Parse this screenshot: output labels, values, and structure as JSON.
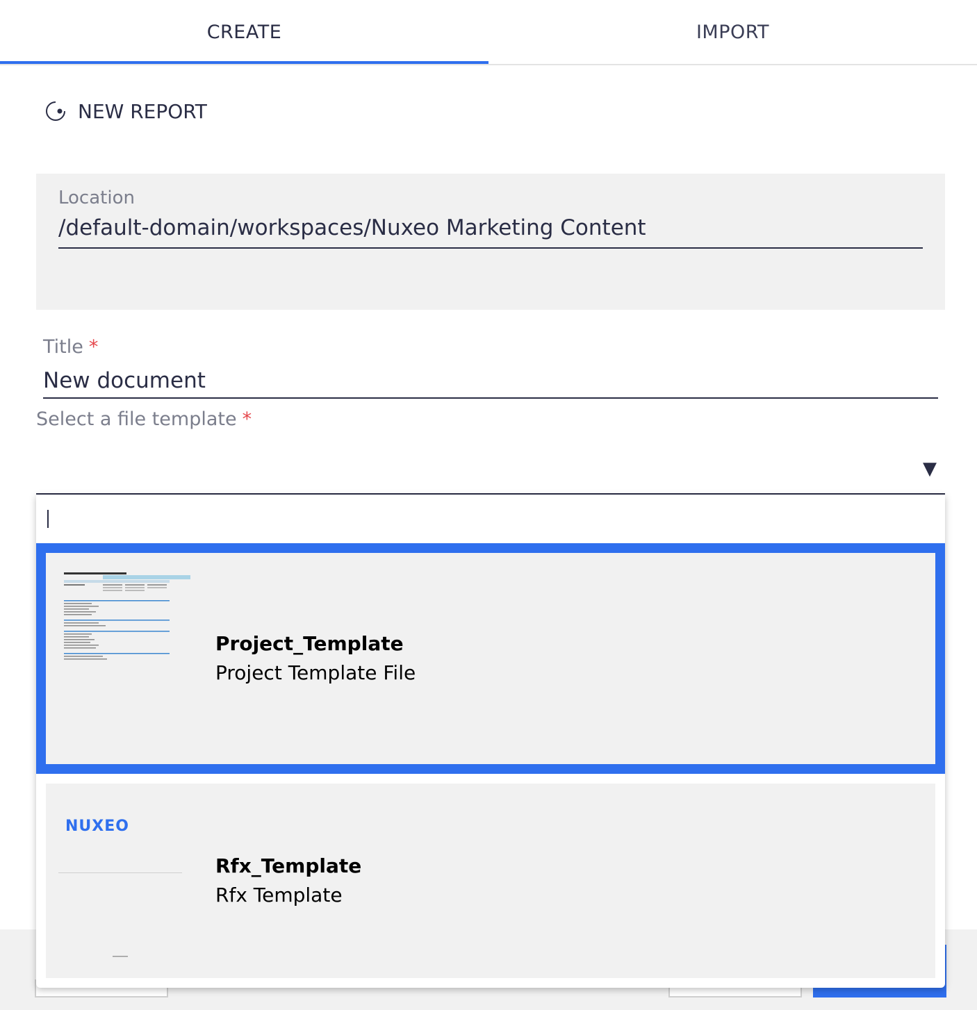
{
  "tabs": [
    {
      "label": "CREATE",
      "active": true
    },
    {
      "label": "IMPORT",
      "active": false
    }
  ],
  "doctype": {
    "label": "NEW REPORT",
    "icon": "report-icon"
  },
  "location": {
    "label": "Location",
    "value": "/default-domain/workspaces/Nuxeo Marketing Content"
  },
  "title_field": {
    "label": "Title",
    "required_mark": "*",
    "value": "New document"
  },
  "template_field": {
    "label": "Select a file template",
    "required_mark": "*",
    "arrow": "▼"
  },
  "dropdown": {
    "search_value": "",
    "items": [
      {
        "name": "Project_Template",
        "description": "Project Template File",
        "selected": true,
        "thumbnail": "spreadsheet-thumbnail"
      },
      {
        "name": "Rfx_Template",
        "description": "Rfx Template",
        "selected": false,
        "thumbnail": "nuxeo-document-thumbnail",
        "thumb_logo": "NUXEO"
      }
    ]
  },
  "colors": {
    "accent": "#2f6fee",
    "field_bg": "#f1f1f1",
    "text": "#2a2d45",
    "required": "#e5484d"
  }
}
